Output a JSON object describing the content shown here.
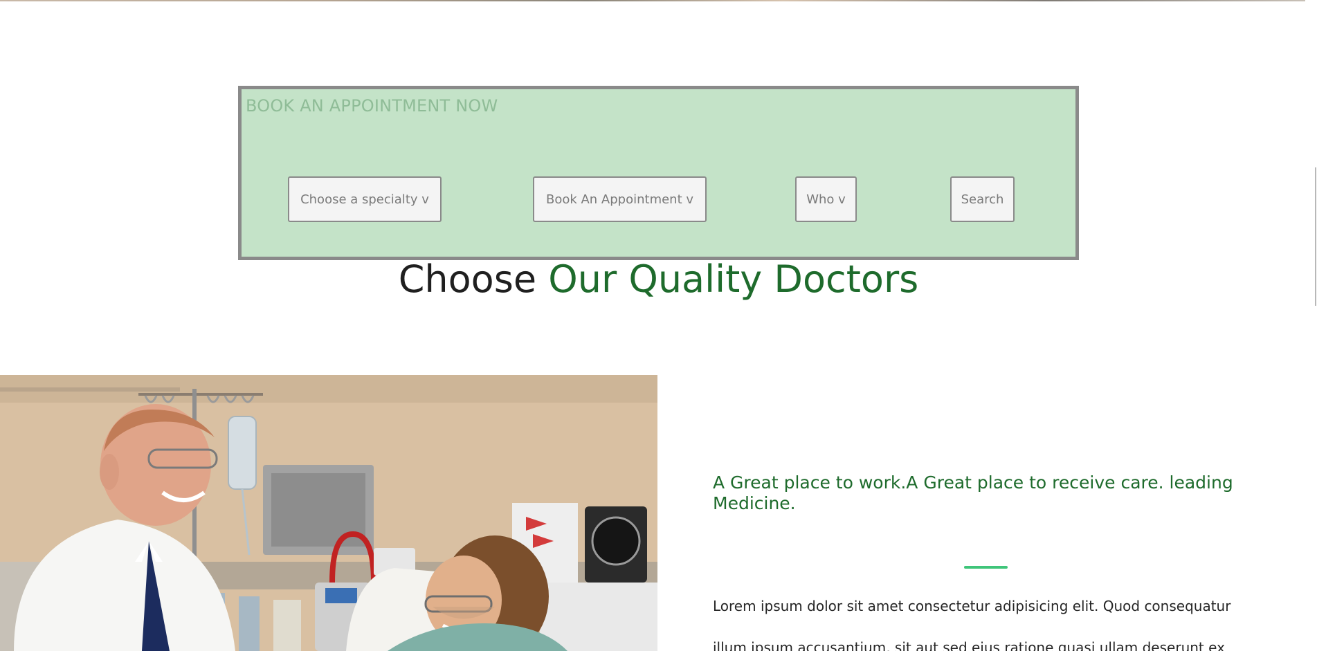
{
  "booking": {
    "title": "BOOK AN APPOINTMENT NOW",
    "specialty_label": "Choose a specialty v",
    "appointment_label": "Book An Appointment v",
    "who_label": "Who v",
    "search_label": "Search"
  },
  "heading": {
    "plain": "Choose ",
    "accent": "Our Quality Doctors"
  },
  "about": {
    "tagline": "A Great place to work.A Great place to receive care. leading Medicine.",
    "body": "Lorem ipsum dolor sit amet consectetur adipisicing elit. Quod consequatur illum ipsum accusantium, sit aut sed eius ratione quasi ullam deserunt ex"
  },
  "colors": {
    "panel_bg": "#c4e3c8",
    "panel_border": "#8a8a8a",
    "accent_green": "#1e6b2c",
    "divider_green": "#3fc57a"
  }
}
